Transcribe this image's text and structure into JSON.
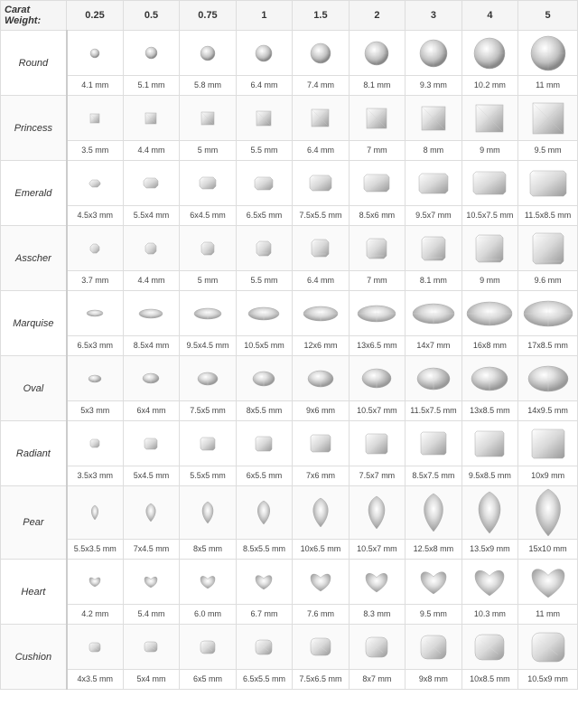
{
  "header": {
    "carat_label": "Carat Weight:",
    "weights": [
      "0.25",
      "0.5",
      "0.75",
      "1",
      "1.5",
      "2",
      "3",
      "4",
      "5"
    ]
  },
  "shapes": [
    {
      "name": "Round",
      "dims": [
        "4.1 mm",
        "5.1 mm",
        "5.8 mm",
        "6.4 mm",
        "7.4 mm",
        "8.1 mm",
        "9.3 mm",
        "10.2 mm",
        "11 mm"
      ]
    },
    {
      "name": "Princess",
      "dims": [
        "3.5 mm",
        "4.4 mm",
        "5 mm",
        "5.5 mm",
        "6.4 mm",
        "7 mm",
        "8 mm",
        "9 mm",
        "9.5 mm"
      ]
    },
    {
      "name": "Emerald",
      "dims": [
        "4.5x3 mm",
        "5.5x4 mm",
        "6x4.5 mm",
        "6.5x5 mm",
        "7.5x5.5 mm",
        "8.5x6 mm",
        "9.5x7 mm",
        "10.5x7.5 mm",
        "11.5x8.5 mm"
      ]
    },
    {
      "name": "Asscher",
      "dims": [
        "3.7 mm",
        "4.4 mm",
        "5 mm",
        "5.5 mm",
        "6.4 mm",
        "7 mm",
        "8.1 mm",
        "9 mm",
        "9.6 mm"
      ]
    },
    {
      "name": "Marquise",
      "dims": [
        "6.5x3 mm",
        "8.5x4 mm",
        "9.5x4.5 mm",
        "10.5x5 mm",
        "12x6 mm",
        "13x6.5 mm",
        "14x7 mm",
        "16x8 mm",
        "17x8.5 mm"
      ]
    },
    {
      "name": "Oval",
      "dims": [
        "5x3 mm",
        "6x4 mm",
        "7.5x5 mm",
        "8x5.5 mm",
        "9x6 mm",
        "10.5x7 mm",
        "11.5x7.5 mm",
        "13x8.5 mm",
        "14x9.5 mm"
      ]
    },
    {
      "name": "Radiant",
      "dims": [
        "3.5x3 mm",
        "5x4.5 mm",
        "5.5x5 mm",
        "6x5.5 mm",
        "7x6 mm",
        "7.5x7 mm",
        "8.5x7.5 mm",
        "9.5x8.5 mm",
        "10x9 mm"
      ]
    },
    {
      "name": "Pear",
      "dims": [
        "5.5x3.5 mm",
        "7x4.5 mm",
        "8x5 mm",
        "8.5x5.5 mm",
        "10x6.5 mm",
        "10.5x7 mm",
        "12.5x8 mm",
        "13.5x9 mm",
        "15x10 mm"
      ]
    },
    {
      "name": "Heart",
      "dims": [
        "4.2 mm",
        "5.4 mm",
        "6.0 mm",
        "6.7 mm",
        "7.6 mm",
        "8.3 mm",
        "9.5 mm",
        "10.3 mm",
        "11 mm"
      ]
    },
    {
      "name": "Cushion",
      "dims": [
        "4x3.5 mm",
        "5x4 mm",
        "6x5 mm",
        "6.5x5.5 mm",
        "7.5x6.5 mm",
        "8x7 mm",
        "9x8 mm",
        "10x8.5 mm",
        "10.5x9 mm"
      ]
    }
  ]
}
